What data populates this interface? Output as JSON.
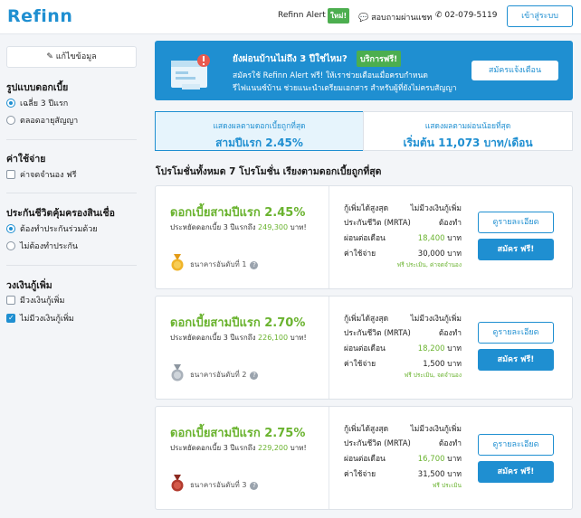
{
  "header": {
    "logo_text": "Refinn",
    "alert_label": "Refinn Alert",
    "new_badge": "ใหม่!",
    "chat_label": "สอบถามผ่านแชท",
    "phone": "02-079-5119",
    "login_button": "เข้าสู่ระบบ"
  },
  "sidebar": {
    "edit_button": "แก้ไขข้อมูล",
    "sections": [
      {
        "title": "รูปแบบดอกเบี้ย",
        "options": [
          {
            "label": "เฉลี่ย 3 ปีแรก",
            "selected": true
          },
          {
            "label": "ตลอดอายุสัญญา",
            "selected": false
          }
        ]
      },
      {
        "title": "ค่าใช้จ่าย",
        "options": [
          {
            "label": "ค่าจดจำนอง ฟรี",
            "selected": false
          }
        ]
      },
      {
        "title": "ประกันชีวิตคุ้มครองสินเชื่อ",
        "options": [
          {
            "label": "ต้องทำประกันร่วมด้วย",
            "selected": true
          },
          {
            "label": "ไม่ต้องทำประกัน",
            "selected": false
          }
        ]
      },
      {
        "title": "วงเงินกู้เพิ่ม",
        "options": [
          {
            "label": "มีวงเงินกู้เพิ่ม",
            "selected": false
          },
          {
            "label": "ไม่มีวงเงินกู้เพิ่ม",
            "selected": true
          }
        ]
      }
    ]
  },
  "banner": {
    "headline": "ยังผ่อนบ้านไม่ถึง 3 ปีใช่ไหม?",
    "badge": "บริการฟรี!",
    "line2": "สมัครใช้ Refinn Alert ฟรี! ให้เราช่วยเตือนเมื่อครบกำหนด",
    "line3": "รีไฟแนนซ์บ้าน ช่วยแนะนำเตรียมเอกสาร สำหรับผู้ที่ยังไม่ครบสัญญา",
    "button": "สมัครแจ้งเตือน",
    "accent_color": "#1f8fd1"
  },
  "sort_tabs": [
    {
      "line1": "แสดงผลตามดอกเบี้ยถูกที่สุด",
      "line2": "สามปีแรก 2.45%",
      "active": true
    },
    {
      "line1": "แสดงผลตามผ่อนน้อยที่สุด",
      "line2": "เริ่มต้น 11,073 บาท/เดือน",
      "active": false
    }
  ],
  "list_title": "โปรโมชั่นทั้งหมด 7 โปรโมชั่น เรียงตามดอกเบี้ยถูกที่สุด",
  "promotions": [
    {
      "rate": "ดอกเบี้ยสามปีแรก 2.45%",
      "saving_prefix": "ประหยัดดอกเบี้ย 3 ปีแรกถึง",
      "saving_amount": "249,300",
      "saving_suffix": "บาท!",
      "bank": "ธนาคารอันดับที่ 1",
      "medal": "gold-medal-icon",
      "medal_color": "#f0b429",
      "max_loan_key": "กู้เพิ่มได้สูงสุด",
      "max_loan_val": "ไม่มีวงเงินกู้เพิ่ม",
      "insurance_key": "ประกันชีวิต (MRTA)",
      "insurance_val": "ต้องทำ",
      "monthly_key": "ผ่อนต่อเดือน",
      "monthly_val": "18,400",
      "monthly_unit": "บาท",
      "cost_key": "ค่าใช้จ่าย",
      "cost_val": "30,000 บาท",
      "note": "ฟรี ประเมิน, ค่าจดจำนอง",
      "detail_button": "ดูรายละเอียด",
      "apply_button": "สมัคร ฟรี!"
    },
    {
      "rate": "ดอกเบี้ยสามปีแรก 2.70%",
      "saving_prefix": "ประหยัดดอกเบี้ย 3 ปีแรกถึง",
      "saving_amount": "226,100",
      "saving_suffix": "บาท!",
      "bank": "ธนาคารอันดับที่ 2",
      "medal": "silver-medal-icon",
      "medal_color": "#a9b1ba",
      "max_loan_key": "กู้เพิ่มได้สูงสุด",
      "max_loan_val": "ไม่มีวงเงินกู้เพิ่ม",
      "insurance_key": "ประกันชีวิต (MRTA)",
      "insurance_val": "ต้องทำ",
      "monthly_key": "ผ่อนต่อเดือน",
      "monthly_val": "18,200",
      "monthly_unit": "บาท",
      "cost_key": "ค่าใช้จ่าย",
      "cost_val": "1,500 บาท",
      "note": "ฟรี ประเมิน, จดจำนอง",
      "detail_button": "ดูรายละเอียด",
      "apply_button": "สมัคร ฟรี!"
    },
    {
      "rate": "ดอกเบี้ยสามปีแรก 2.75%",
      "saving_prefix": "ประหยัดดอกเบี้ย 3 ปีแรกถึง",
      "saving_amount": "229,200",
      "saving_suffix": "บาท!",
      "bank": "ธนาคารอันดับที่ 3",
      "medal": "bronze-medal-icon",
      "medal_color": "#b23b2e",
      "max_loan_key": "กู้เพิ่มได้สูงสุด",
      "max_loan_val": "ไม่มีวงเงินกู้เพิ่ม",
      "insurance_key": "ประกันชีวิต (MRTA)",
      "insurance_val": "ต้องทำ",
      "monthly_key": "ผ่อนต่อเดือน",
      "monthly_val": "16,700",
      "monthly_unit": "บาท",
      "cost_key": "ค่าใช้จ่าย",
      "cost_val": "31,500 บาท",
      "note": "ฟรี ประเมิน",
      "detail_button": "ดูรายละเอียด",
      "apply_button": "สมัคร ฟรี!"
    }
  ]
}
